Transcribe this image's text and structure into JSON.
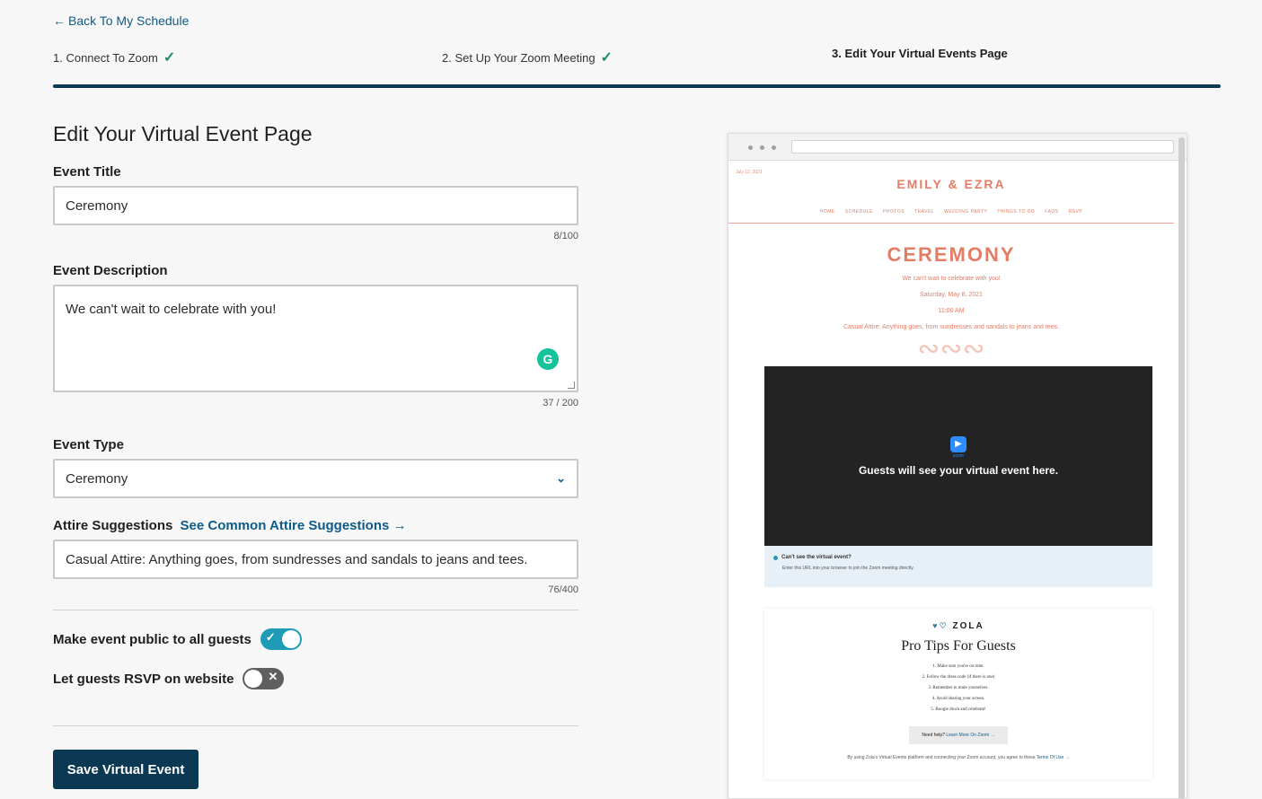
{
  "back_link": "Back To My Schedule",
  "steps": [
    {
      "label": "1. Connect To Zoom",
      "done": true
    },
    {
      "label": "2. Set Up Your Zoom Meeting",
      "done": true
    },
    {
      "label": "3. Edit Your Virtual Events Page",
      "done": false
    }
  ],
  "form": {
    "heading": "Edit Your Virtual Event Page",
    "title_label": "Event Title",
    "title_value": "Ceremony",
    "title_counter": "8/100",
    "desc_label": "Event Description",
    "desc_value": "We can't wait to celebrate with you!",
    "desc_counter": "37 / 200",
    "type_label": "Event Type",
    "type_value": "Ceremony",
    "attire_label": "Attire Suggestions",
    "attire_link": "See Common Attire Suggestions",
    "attire_value": "Casual Attire: Anything goes, from sundresses and sandals to jeans and tees.",
    "attire_counter": "76/400",
    "public_label": "Make event public to all guests",
    "public_on": true,
    "rsvp_label": "Let guests RSVP on website",
    "rsvp_on": false,
    "save_label": "Save Virtual Event"
  },
  "preview": {
    "date": "July 12, 2021",
    "couple": "EMILY & EZRA",
    "nav": [
      "HOME",
      "SCHEDULE",
      "PHOTOS",
      "TRAVEL",
      "WEDDING PARTY",
      "THINGS TO DO",
      "FAQS",
      "RSVP"
    ],
    "event_title": "CEREMONY",
    "event_desc": "We can't wait to celebrate with you!",
    "event_date": "Saturday, May 8, 2021",
    "event_time": "11:00 AM",
    "event_attire": "Casual Attire: Anything goes, from sundresses and sandals to jeans and tees.",
    "zoom_word": "zoom",
    "video_text": "Guests will see your virtual event here.",
    "cant_title": "Can't see the virtual event?",
    "cant_desc": "Enter this URL into your browser to join the Zoom meeting directly.",
    "zola_brand": "ZOLA",
    "tips_title": "Pro Tips For Guests",
    "tips": [
      "1. Make sure you're on time.",
      "2. Follow the dress code (if there is one)",
      "3. Remember to mute yourselves.",
      "4. Avoid sharing your screen.",
      "5. Boogie down and celebrate!"
    ],
    "help_text": "Need help?",
    "help_link": "Learn More On Zoom",
    "terms_text": "By using Zola's Virtual Events platform and connecting your Zoom account, you agree to these",
    "terms_link": "Terms Of Use"
  },
  "colors": {
    "accent": "#0b3954",
    "link": "#0e5b88",
    "coral": "#e47c66",
    "toggle_on": "#1e9bb7"
  }
}
